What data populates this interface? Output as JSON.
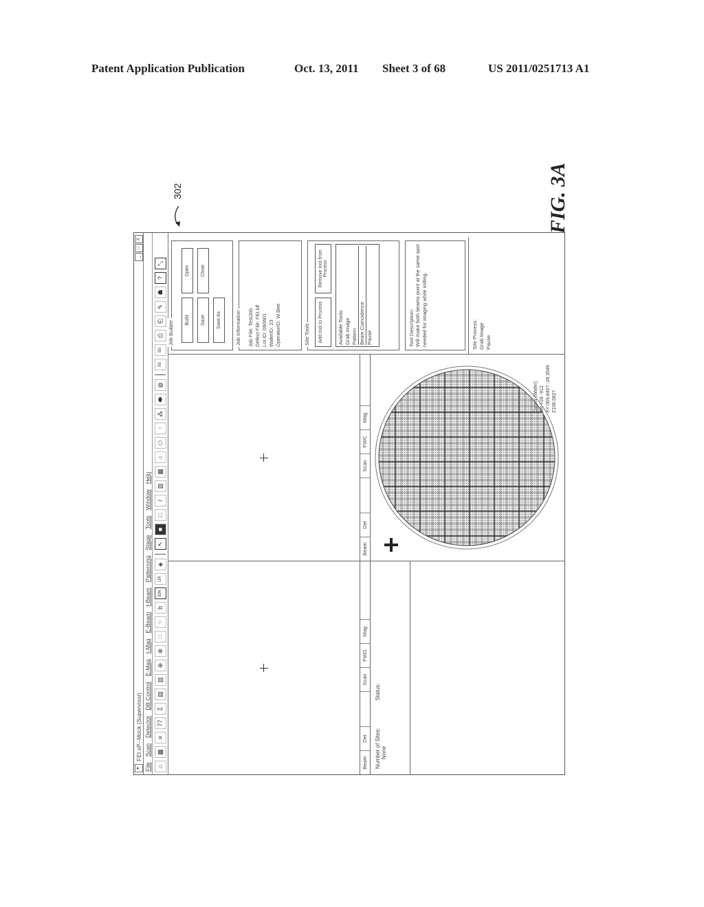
{
  "header": {
    "publication": "Patent Application Publication",
    "date": "Oct. 13, 2011",
    "sheet": "Sheet 3 of 68",
    "number": "US 2011/0251713 A1"
  },
  "figure": {
    "label": "FIG. 3A",
    "reference": "302"
  },
  "app": {
    "title": "FEI xP--Mock (Supervisor)",
    "window_buttons": [
      "_",
      "□",
      "X"
    ],
    "menu": [
      "File",
      "Scan",
      "Detector",
      "DB Control",
      "E-Mag",
      "I-Mag",
      "E-Beam",
      "I-Beam",
      "Patterning",
      "Stage",
      "Tools",
      "Window",
      "Help"
    ],
    "toolbar_icons": [
      "stage-icon",
      "grid-icon",
      "list-icon",
      "77",
      "sum-icon",
      "screen-a-icon",
      "screen-b-icon",
      "ion-gun-icon",
      "electron-gun-icon",
      "ib-icon",
      "eb-icon",
      "focus-icon",
      "50K",
      "UR",
      "diamond-icon",
      "select-arrow-icon",
      "filled-rect-icon",
      "rect-icon",
      "line-icon",
      "hatched-icon",
      "grid-rect-icon",
      "circle-icon",
      "poly-icon",
      "dots-icon",
      "dots-grid-icon",
      "pill-icon",
      "sphere-icon",
      "50",
      "50",
      "printer-icon",
      "printer2-icon",
      "edit-icon",
      "bug-icon",
      "help-icon",
      "cursor-help-icon"
    ],
    "left_pane_tabs": [
      "Beam",
      "Det",
      "",
      "Scan",
      "FWG",
      "Mag"
    ],
    "right_pane_tabs": [
      "Beam",
      "Det",
      "",
      "Scan",
      "FWC",
      "Mag"
    ],
    "sites": {
      "number_label": "Number of Sites:",
      "number_value": "None",
      "status_label": "Status:"
    },
    "cursor_readout": {
      "title": "Cursor (Wafer)",
      "dr": "DR +28 -912",
      "xy": "XY 069.8407 -28.3546",
      "z": "Z108.5827"
    },
    "job_builder": {
      "title": "Job Builder",
      "buttons": [
        "Build",
        "Open",
        "Save",
        "Close",
        "Save As"
      ]
    },
    "job_info": {
      "title": "Job Information",
      "lines": [
        "Job File: TestJob",
        "Defect File: FEI.klf",
        "Lot ID: 060601",
        "WaferID: 23",
        "OperatorID: W.Bee"
      ]
    },
    "site_tools": {
      "title": "Site Tools",
      "add_button": "Add tool to Process",
      "remove_button": "Remove tool from Process",
      "available_label": "Available Tools:",
      "tools": [
        "Grab Image",
        "Pattern",
        "Beam Coincidence",
        "Pause"
      ],
      "selected_index": 2
    },
    "tool_description": {
      "label": "Tool Description:",
      "text": "Will make both beams point at the same spot needed for imaging while milling."
    },
    "site_process": {
      "label": "Site Process:",
      "steps": [
        "Grab Image",
        "Pause"
      ]
    }
  }
}
